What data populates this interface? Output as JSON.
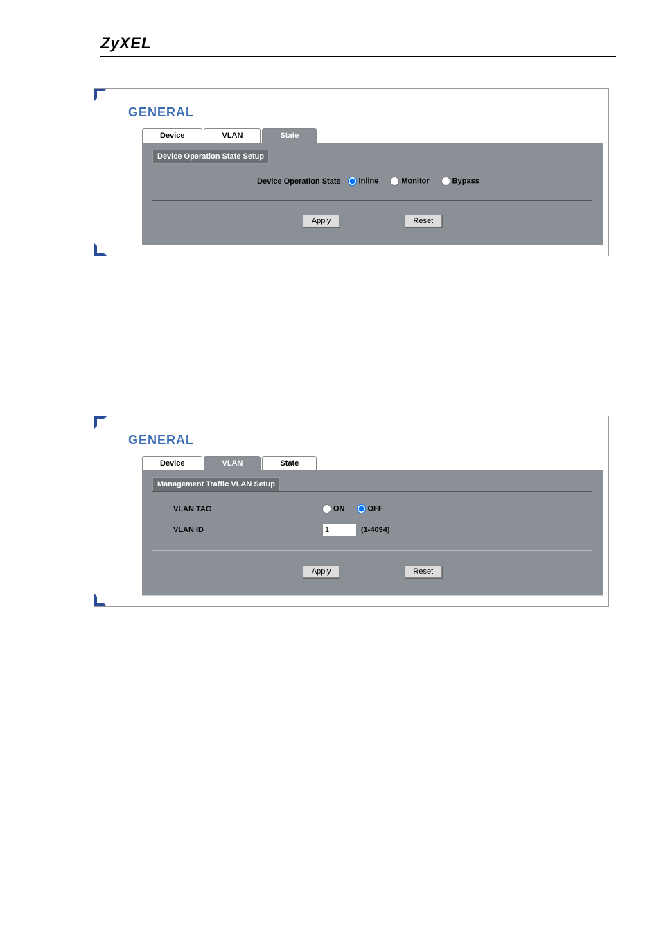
{
  "brand": "ZyXEL",
  "panel1": {
    "title": "GENERAL",
    "tabs": [
      {
        "label": "Device",
        "active": false
      },
      {
        "label": "VLAN",
        "active": false
      },
      {
        "label": "State",
        "active": true
      }
    ],
    "section_header": "Device Operation State Setup",
    "form_label": "Device Operation State",
    "radios": [
      {
        "label": "Inline",
        "checked": true
      },
      {
        "label": "Monitor",
        "checked": false
      },
      {
        "label": "Bypass",
        "checked": false
      }
    ],
    "apply_label": "Apply",
    "reset_label": "Reset"
  },
  "panel2": {
    "title": "GENERAL",
    "tabs": [
      {
        "label": "Device",
        "active": false
      },
      {
        "label": "VLAN",
        "active": true
      },
      {
        "label": "State",
        "active": false
      }
    ],
    "section_header": "Management Traffic VLAN Setup",
    "vlan_tag_label": "VLAN TAG",
    "vlan_tag_radios": [
      {
        "label": "ON",
        "checked": false
      },
      {
        "label": "OFF",
        "checked": true
      }
    ],
    "vlan_id_label": "VLAN ID",
    "vlan_id_value": "1",
    "vlan_id_range": "(1-4094)",
    "apply_label": "Apply",
    "reset_label": "Reset"
  }
}
